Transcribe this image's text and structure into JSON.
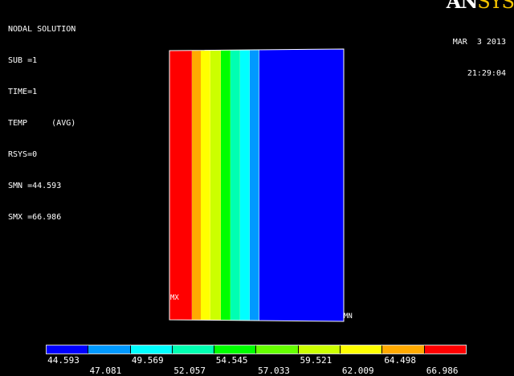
{
  "info": {
    "title": "NODAL SOLUTION",
    "sub": "SUB =1",
    "time": "TIME=1",
    "temp": "TEMP     (AVG)",
    "rsys": "RSYS=0",
    "smn": "SMN =44.593",
    "smx": "SMX =66.986"
  },
  "datetime": {
    "date": "MAR  3 2013",
    "time": "21:29:04"
  },
  "logo": {
    "part1": "AN",
    "part2": "SYS"
  },
  "markers": {
    "mx": "MX",
    "mn": "MN"
  },
  "legend": {
    "colors": [
      "#0000ff",
      "#0099ff",
      "#00ffff",
      "#00ffb2",
      "#00ff00",
      "#66ff00",
      "#ccff00",
      "#ffff00",
      "#ffaa00",
      "#ff0000"
    ],
    "values_top": [
      "44.593",
      "49.569",
      "54.545",
      "59.521",
      "64.498"
    ],
    "values_bottom": [
      "47.081",
      "52.057",
      "57.033",
      "62.009",
      "66.986"
    ]
  },
  "contour_bands": [
    {
      "color": "#ff0000"
    },
    {
      "color": "#ffaa00"
    },
    {
      "color": "#ffff00"
    },
    {
      "color": "#ccff00"
    },
    {
      "color": "#00ff00"
    },
    {
      "color": "#00ffb2"
    },
    {
      "color": "#00ffff"
    },
    {
      "color": "#0099ff"
    },
    {
      "color": "#0000ff"
    }
  ]
}
